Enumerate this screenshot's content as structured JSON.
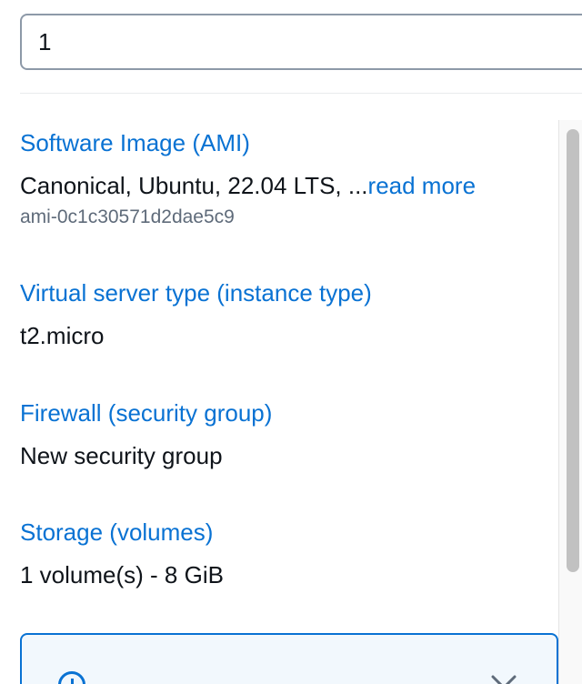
{
  "instances": {
    "value": "1"
  },
  "summary": {
    "ami": {
      "label": "Software Image (AMI)",
      "value": "Canonical, Ubuntu, 22.04 LTS, ...",
      "read_more": "read more",
      "id": "ami-0c1c30571d2dae5c9"
    },
    "instance_type": {
      "label": "Virtual server type (instance type)",
      "value": "t2.micro"
    },
    "firewall": {
      "label": "Firewall (security group)",
      "value": "New security group"
    },
    "storage": {
      "label": "Storage (volumes)",
      "value": "1 volume(s) - 8 GiB"
    }
  },
  "alert": {
    "icon": "info-icon",
    "dismiss_icon": "close-icon"
  },
  "colors": {
    "link": "#0972d3",
    "text": "#0f141a",
    "secondary_text": "#5f6b7a",
    "input_border": "#8d99a8",
    "alert_border": "#0972d3",
    "alert_background": "#f2f8fd"
  }
}
